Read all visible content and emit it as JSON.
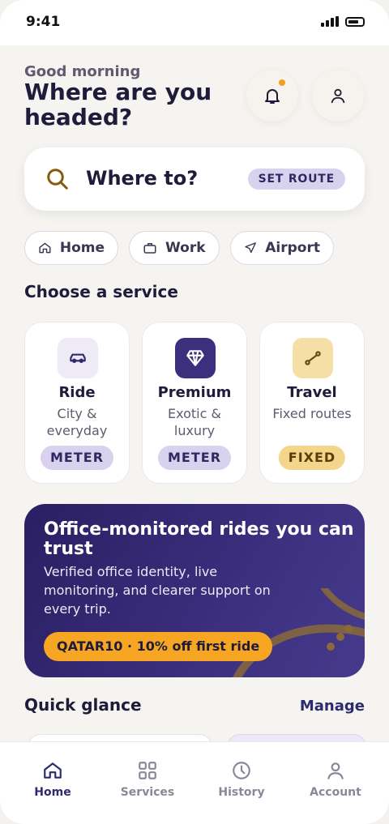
{
  "status_bar": {
    "time": "9:41"
  },
  "header": {
    "greeting": "Good morning",
    "headline": "Where are you headed?"
  },
  "search": {
    "placeholder": "Where to?",
    "action_label": "SET ROUTE"
  },
  "quick_destinations": [
    {
      "label": "Home",
      "icon": "home-icon"
    },
    {
      "label": "Work",
      "icon": "briefcase-icon"
    },
    {
      "label": "Airport",
      "icon": "plane-icon"
    }
  ],
  "services_section": {
    "title": "Choose a service",
    "cards": [
      {
        "title": "Ride",
        "subtitle": "City & everyday",
        "badge": "METER",
        "icon": "car-icon",
        "icon_bg": "#eeebf7",
        "badge_bg": "#d9d2ef",
        "badge_color": "#2e2a60"
      },
      {
        "title": "Premium",
        "subtitle": "Exotic & luxury",
        "badge": "METER",
        "icon": "diamond-icon",
        "icon_bg": "#3b2f7e",
        "badge_bg": "#d9d2ef",
        "badge_color": "#2e2a60"
      },
      {
        "title": "Travel",
        "subtitle": "Fixed routes",
        "badge": "FIXED",
        "icon": "route-icon",
        "icon_bg": "#f5dfa6",
        "badge_bg": "#f3d68c",
        "badge_color": "#5a3d05"
      }
    ]
  },
  "promo": {
    "title": "Office-monitored rides you can trust",
    "body": "Verified office identity, live monitoring, and clearer support on every trip.",
    "code": "QATAR10 · 10% off first ride"
  },
  "quick_glance": {
    "title": "Quick glance",
    "action": "Manage"
  },
  "bottom_nav": [
    {
      "label": "Home",
      "icon": "home-icon",
      "active": true
    },
    {
      "label": "Services",
      "icon": "grid-icon",
      "active": false
    },
    {
      "label": "History",
      "icon": "clock-icon",
      "active": false
    },
    {
      "label": "Account",
      "icon": "user-icon",
      "active": false
    }
  ],
  "colors": {
    "brand": "#2e2a70",
    "accent": "#f6a623",
    "background": "#f6f4f1"
  }
}
